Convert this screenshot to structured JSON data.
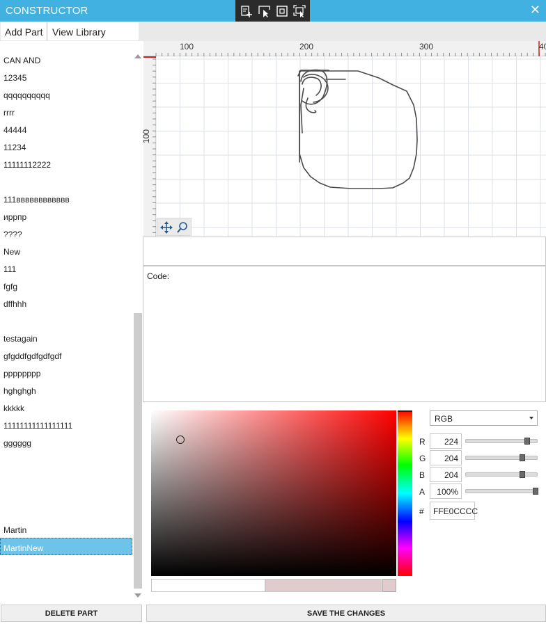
{
  "window": {
    "title": "CONSTRUCTOR",
    "close_glyph": "✕"
  },
  "dev_toolbar": {
    "icons": [
      "live-visual-tree-icon",
      "select-element-icon",
      "display-layout-adorners-icon",
      "track-focused-element-icon"
    ]
  },
  "tabs": [
    {
      "label": "Add Part"
    },
    {
      "label": "View Library"
    }
  ],
  "parts_list": {
    "items": [
      "CAN AND",
      "12345",
      "qqqqqqqqqq",
      "rrrr",
      "44444",
      "11234",
      "11111112222",
      "",
      "111вввввввввввв",
      "иррпр",
      "????",
      "New",
      "111",
      "fgfg",
      "dffhhh",
      "",
      "testagain",
      "gfgddfgdfgdfgdf",
      "pppppppp",
      "hghghgh",
      "kkkkk",
      "11111111111111111",
      "gggggg",
      "",
      "",
      "",
      "",
      "Martin",
      "MartinNew"
    ],
    "selected": "MartinNew"
  },
  "ruler": {
    "top_labels": [
      "100",
      "200",
      "300",
      "40"
    ],
    "left_label": "100"
  },
  "canvas_tools": {
    "icons": [
      "pan-icon",
      "zoom-icon"
    ]
  },
  "code": {
    "label": "Code:"
  },
  "color_picker": {
    "mode": "RGB",
    "channels": [
      {
        "label": "R",
        "value": "224",
        "fraction": 0.878
      },
      {
        "label": "G",
        "value": "204",
        "fraction": 0.8
      },
      {
        "label": "B",
        "value": "204",
        "fraction": 0.8
      },
      {
        "label": "A",
        "value": "100%",
        "fraction": 1.0
      }
    ],
    "hex_label": "#",
    "hex_value": "FFE0CCCC",
    "current_color": "#e0cccc",
    "hue_color": "#ff0000"
  },
  "buttons": {
    "delete": "DELETE PART",
    "save": "SAVE THE CHANGES"
  },
  "colors": {
    "titlebar": "#41b1e1",
    "selection": "#6ec3e8"
  }
}
